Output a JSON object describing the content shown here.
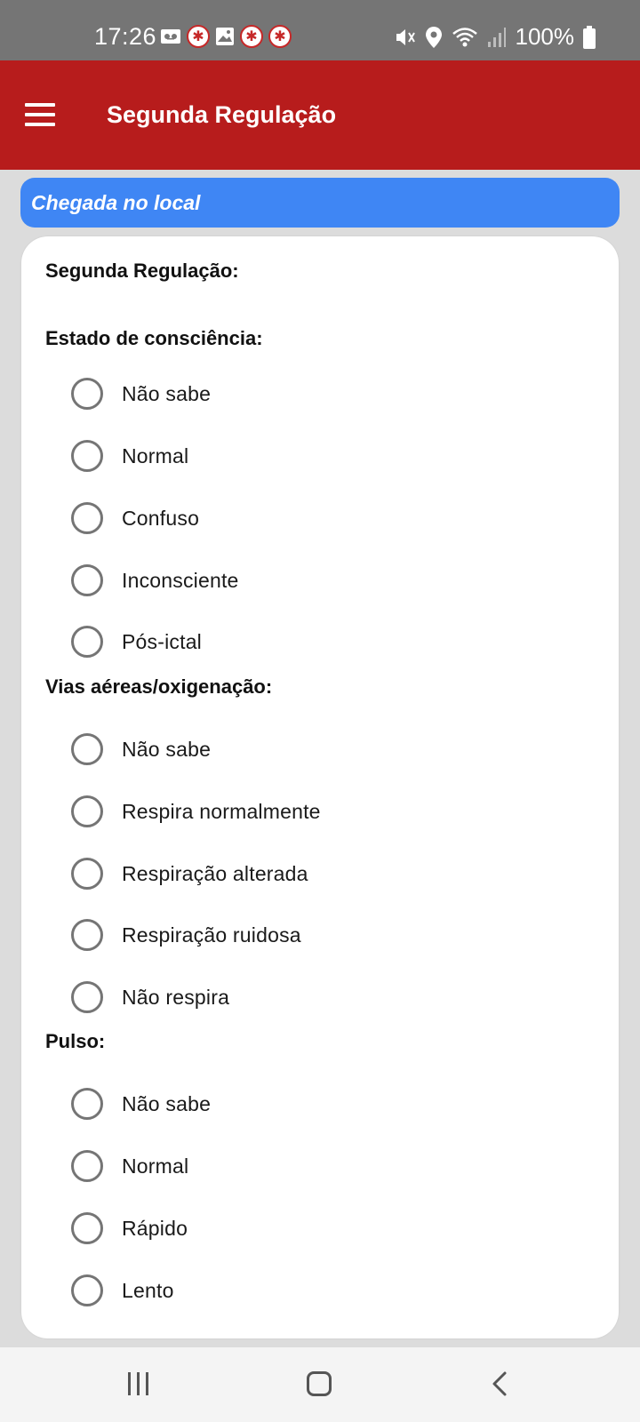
{
  "status_bar": {
    "time": "17:26",
    "battery": "100%",
    "left_icons": [
      "voicemail-icon",
      "emblem-icon",
      "gallery-icon",
      "emblem-icon",
      "emblem-icon"
    ],
    "right_icons": [
      "mute-icon",
      "location-icon",
      "wifi-icon",
      "signal-icon",
      "battery-icon"
    ]
  },
  "app_bar": {
    "title": "Segunda Regulação",
    "menu_icon": "menu-icon",
    "background": "#b71c1c"
  },
  "banner": {
    "text": "Chegada no local",
    "color": "#3f86f4"
  },
  "form": {
    "title": "Segunda Regulação:",
    "groups": [
      {
        "label": "Estado de consciência:",
        "options": [
          "Não sabe",
          "Normal",
          "Confuso",
          "Inconsciente",
          "Pós-ictal"
        ]
      },
      {
        "label": "Vias aéreas/oxigenação:",
        "options": [
          "Não sabe",
          "Respira normalmente",
          "Respiração alterada",
          "Respiração ruidosa",
          "Não respira"
        ]
      },
      {
        "label": "Pulso:",
        "options": [
          "Não sabe",
          "Normal",
          "Rápido",
          "Lento"
        ]
      }
    ]
  },
  "nav_bar": {
    "icons": [
      "recents-icon",
      "home-icon",
      "back-icon"
    ]
  }
}
